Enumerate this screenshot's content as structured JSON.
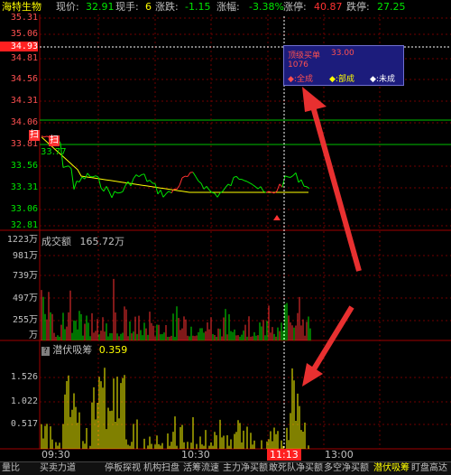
{
  "header": {
    "stock_name": "海特生物",
    "price_label": "现价:",
    "price_value": "32.91",
    "volume_label": "现手:",
    "volume_value": "6",
    "change_label": "涨跌:",
    "change_value": "-1.15",
    "change_pct_label": "涨幅:",
    "change_pct_value": "-3.38%",
    "limit_up_label": "涨停:",
    "limit_up_value": "40.87",
    "limit_down_label": "跌停:",
    "limit_down_value": "27.25"
  },
  "price_axis": {
    "labels": [
      "35.31",
      "35.06",
      "34.93",
      "34.81",
      "34.56",
      "34.31",
      "34.06",
      "33.81",
      "33.56",
      "33.31",
      "33.06",
      "32.81"
    ],
    "highlighted": "34.93"
  },
  "markers": {
    "sweep": "扫",
    "last_price": "33.77"
  },
  "volume_panel": {
    "title": "成交额",
    "value": "165.72万",
    "axis": [
      "1223万",
      "981万",
      "739万",
      "497万",
      "255万",
      "万"
    ]
  },
  "indicator_panel": {
    "help": "?",
    "title": "潜伏吸筹",
    "value": "0.359",
    "axis": [
      "1.526",
      "1.022",
      "0.517"
    ]
  },
  "time_axis": {
    "labels": [
      "09:30",
      "10:30",
      "11:13",
      "13:00"
    ],
    "current": "11:13"
  },
  "popup": {
    "line1_label": "顶级买单",
    "line1_value": "33.00",
    "line2": "1076",
    "opt_all": "◆:全成",
    "opt_part": "◆:部成",
    "opt_none": "◆:未成"
  },
  "tabs": [
    "量比",
    "买卖力道",
    "停板探视",
    "机构扫盘",
    "活筹流速",
    "主力净买额",
    "敢死队净买额",
    "多空净买额",
    "潜伏吸筹",
    "盯盘高达"
  ],
  "active_tab": "潜伏吸筹",
  "colors": {
    "up": "#ff3232",
    "down": "#00e600",
    "yellow": "#ffff00",
    "grid": "#800000",
    "axis_text_up": "#ff5050"
  }
}
